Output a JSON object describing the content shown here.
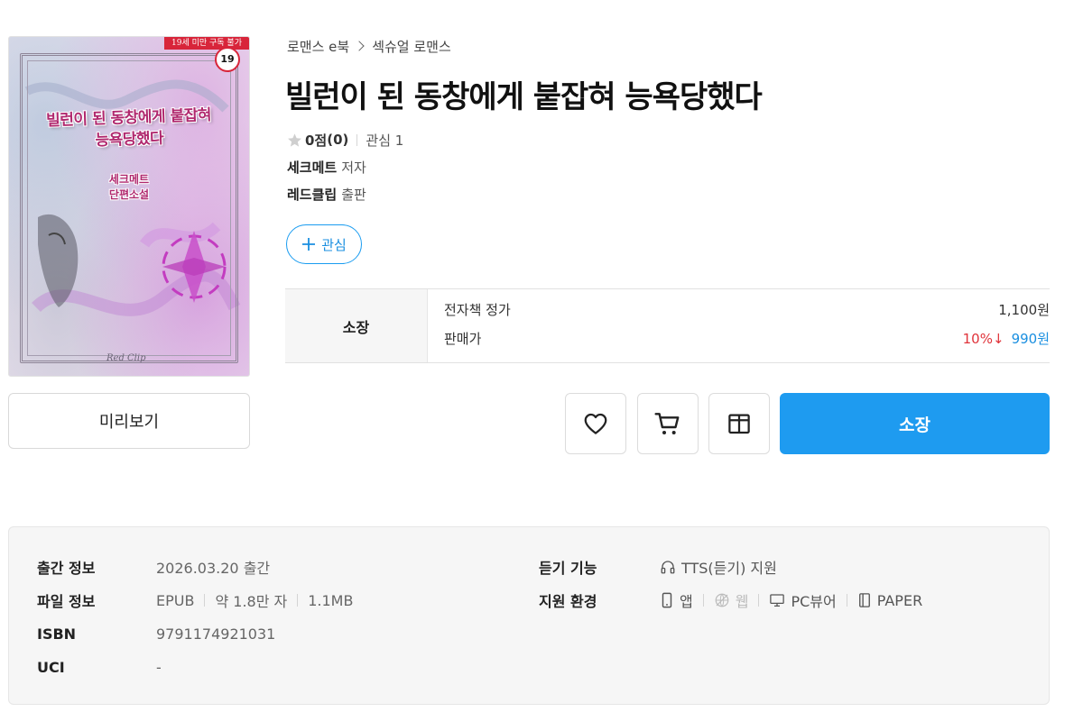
{
  "cover": {
    "title_line1": "빌런이 된 동창에게 붙잡혀",
    "title_line2": "능욕당했다",
    "sub_line1": "세크메트",
    "sub_line2": "단편소설",
    "age_notice": "19세 미만 구독 불가",
    "age_badge": "19",
    "publisher_logo": "Red Clip"
  },
  "preview_label": "미리보기",
  "breadcrumb": [
    "로맨스 e북",
    "섹슈얼 로맨스"
  ],
  "title": "빌런이 된 동창에게 붙잡혀 능욕당했다",
  "rating": {
    "score": "0점",
    "count": "(0)",
    "wish": "관심 1"
  },
  "author": {
    "name": "세크메트",
    "role": "저자"
  },
  "publisher": {
    "name": "레드클립",
    "role": "출판"
  },
  "wish_button": {
    "icon": "plus-icon",
    "label": "관심"
  },
  "price": {
    "head": "소장",
    "list_label": "전자책 정가",
    "list_value": "1,100원",
    "sale_label": "판매가",
    "discount": "10%↓",
    "sale_value": "990원",
    "discount_color": "#e0333a",
    "sale_color": "#1a8fe0"
  },
  "actions": {
    "icons": [
      "heart-icon",
      "cart-icon",
      "gift-icon"
    ],
    "buy_label": "소장",
    "buy_color": "#1e9bf0"
  },
  "details": {
    "publish": {
      "label": "출간 정보",
      "value": "2026.03.20 출간"
    },
    "file": {
      "label": "파일 정보",
      "format": "EPUB",
      "length": "약 1.8만 자",
      "size": "1.1MB"
    },
    "isbn": {
      "label": "ISBN",
      "value": "9791174921031"
    },
    "uci": {
      "label": "UCI",
      "value": "-"
    },
    "listen": {
      "label": "듣기 기능",
      "icon": "headphones-icon",
      "value": "TTS(듣기) 지원"
    },
    "env": {
      "label": "지원 환경",
      "items": [
        {
          "icon": "phone-icon",
          "label": "앱",
          "enabled": true
        },
        {
          "icon": "web-disabled-icon",
          "label": "웹",
          "enabled": false
        },
        {
          "icon": "monitor-icon",
          "label": "PC뷰어",
          "enabled": true
        },
        {
          "icon": "paper-icon",
          "label": "PAPER",
          "enabled": true
        }
      ]
    }
  }
}
